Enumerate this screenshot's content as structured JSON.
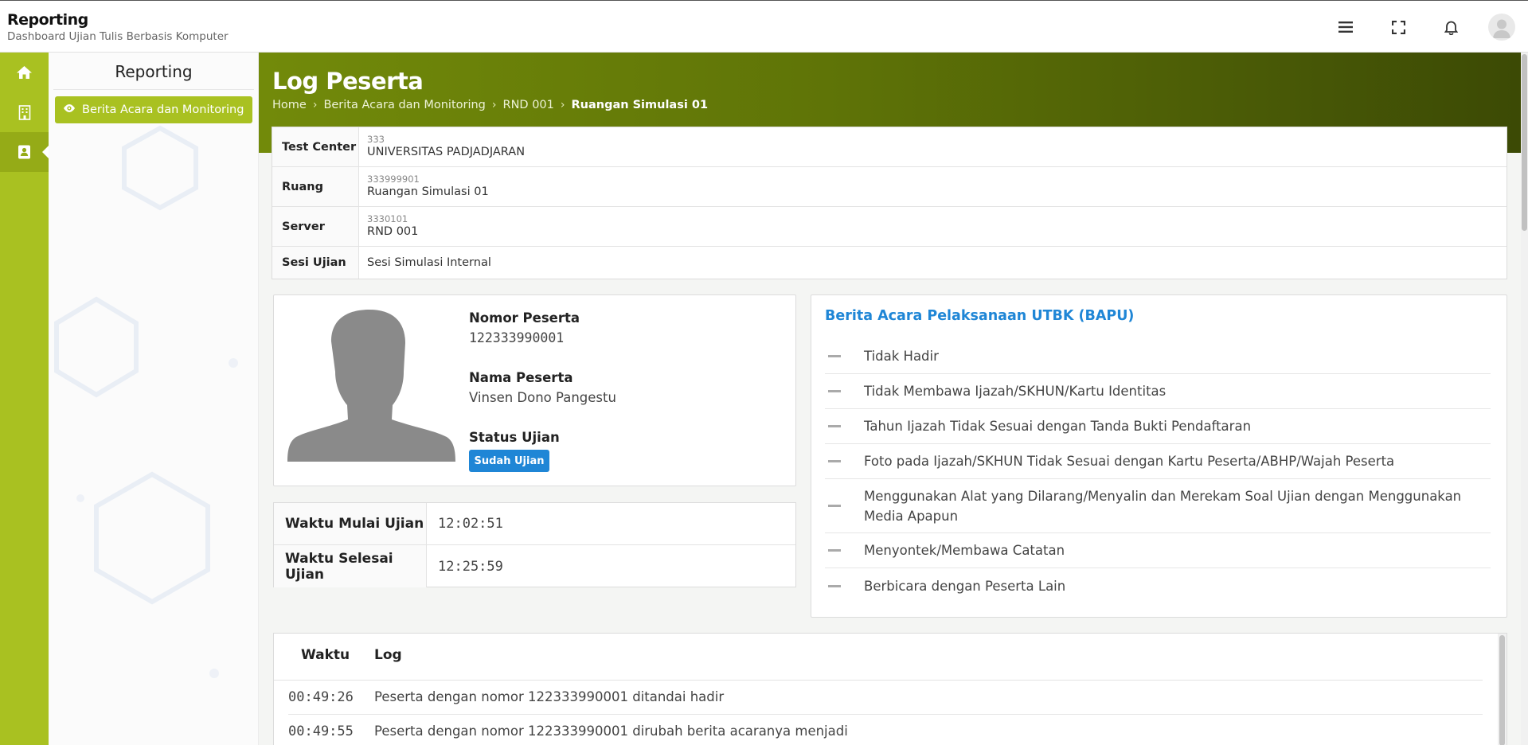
{
  "header": {
    "title": "Reporting",
    "subtitle": "Dashboard Ujian Tulis Berbasis Komputer",
    "icons": [
      "menu-icon",
      "fullscreen-icon",
      "bell-icon",
      "avatar"
    ]
  },
  "rail": {
    "items": [
      "home-icon",
      "building-icon",
      "report-icon"
    ],
    "active_index": 2
  },
  "sidebar": {
    "title": "Reporting",
    "active_item": "Berita Acara dan Monitoring"
  },
  "page": {
    "title": "Log Peserta",
    "breadcrumb": [
      "Home",
      "Berita Acara dan Monitoring",
      "RND 001",
      "Ruangan Simulasi 01"
    ]
  },
  "info": [
    {
      "label": "Test Center",
      "code": "333",
      "name": "UNIVERSITAS PADJADJARAN"
    },
    {
      "label": "Ruang",
      "code": "333999901",
      "name": "Ruangan Simulasi 01"
    },
    {
      "label": "Server",
      "code": "3330101",
      "name": "RND 001"
    },
    {
      "label": "Sesi Ujian",
      "code": "",
      "name": "Sesi Simulasi Internal"
    }
  ],
  "participant": {
    "number_label": "Nomor Peserta",
    "number": "122333990001",
    "name_label": "Nama Peserta",
    "name": "Vinsen Dono Pangestu",
    "status_label": "Status Ujian",
    "status": "Sudah Ujian"
  },
  "times": [
    {
      "label": "Waktu Mulai Ujian",
      "value": "12:02:51"
    },
    {
      "label": "Waktu Selesai Ujian",
      "value": "12:25:59"
    }
  ],
  "bapu": {
    "title": "Berita Acara Pelaksanaan UTBK (BAPU)",
    "items": [
      "Tidak Hadir",
      "Tidak Membawa Ijazah/SKHUN/Kartu Identitas",
      "Tahun Ijazah Tidak Sesuai dengan Tanda Bukti Pendaftaran",
      "Foto pada Ijazah/SKHUN Tidak Sesuai dengan Kartu Peserta/ABHP/Wajah Peserta",
      "Menggunakan Alat yang Dilarang/Menyalin dan Merekam Soal Ujian dengan Menggunakan Media Apapun",
      "Menyontek/Membawa Catatan",
      "Berbicara dengan Peserta Lain"
    ]
  },
  "log": {
    "columns": [
      "Waktu",
      "Log"
    ],
    "rows": [
      {
        "time": "00:49:26",
        "message": "Peserta dengan nomor 122333990001 ditandai hadir"
      },
      {
        "time": "00:49:55",
        "message": "Peserta dengan nomor 122333990001 dirubah berita acaranya menjadi"
      }
    ]
  },
  "colors": {
    "accent": "#a9c121",
    "banner_start": "#728a0a",
    "banner_end": "#3c4a05",
    "status_badge": "#1f86d6",
    "bapu_title": "#1f86d6"
  }
}
